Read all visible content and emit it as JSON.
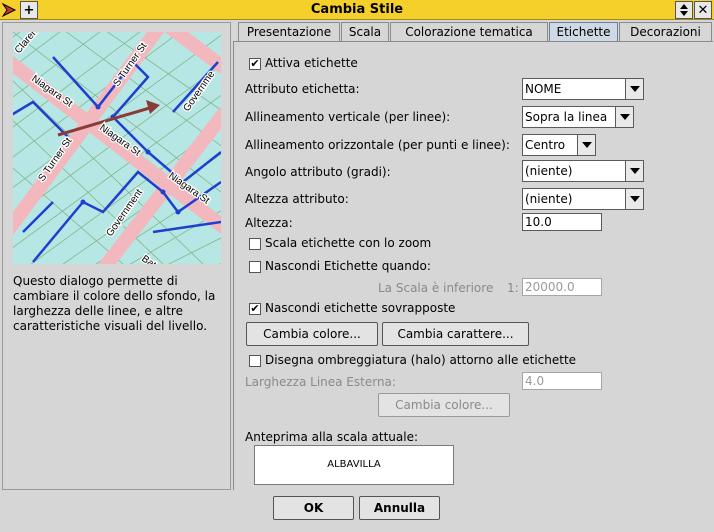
{
  "window": {
    "title": "Cambia Stile",
    "controls": [
      "arrow-updown-icon",
      "close-icon"
    ]
  },
  "map": {
    "street_labels": [
      "Claren",
      "Niagara St",
      "S Turner St",
      "Governme",
      "Niagara St",
      "S Turner St",
      "Niagara St",
      "Government",
      "Bat"
    ]
  },
  "description": "Questo dialogo  permette di cambiare il colore dello sfondo, la larghezza delle linee, e altre caratteristiche visuali del livello.",
  "tabs": [
    {
      "label": "Presentazione",
      "active": false
    },
    {
      "label": "Scala",
      "active": false
    },
    {
      "label": "Colorazione tematica",
      "active": false
    },
    {
      "label": "Etichette",
      "active": true
    },
    {
      "label": "Decorazioni",
      "active": false
    }
  ],
  "form": {
    "enable_labels": {
      "label": "Attiva etichette",
      "checked": true
    },
    "label_attribute": {
      "label": "Attributo etichetta:",
      "value": "NOME"
    },
    "vertical_alignment": {
      "label": "Allineamento verticale (per linee):",
      "value": "Sopra la linea"
    },
    "horizontal_alignment": {
      "label": "Allineamento orizzontale (per punti e linee):",
      "value": "Centro"
    },
    "angle_attribute": {
      "label": "Angolo attributo (gradi):",
      "value": "(niente)"
    },
    "height_attribute": {
      "label": "Altezza attributo:",
      "value": "(niente)"
    },
    "height": {
      "label": "Altezza:",
      "value": "10.0"
    },
    "scale_with_zoom": {
      "label": "Scala  etichette con lo zoom",
      "checked": false
    },
    "hide_labels_when": {
      "label": "Nascondi Etichette quando:",
      "checked": false
    },
    "scale_lower": {
      "label": "La Scala è inferiore",
      "prefix": "1:",
      "value": "20000.0"
    },
    "hide_overlapping": {
      "label": "Nascondi etichette sovrapposte",
      "checked": true
    },
    "change_color_button": "Cambia colore...",
    "change_font_button": "Cambia carattere...",
    "draw_halo": {
      "label": "Disegna ombreggiatura (halo) attorno alle etichette",
      "checked": false
    },
    "outline_width": {
      "label": "Larghezza  Linea Esterna:",
      "value": "4.0"
    },
    "halo_color_button": "Cambia colore...",
    "preview": {
      "label": "Anteprima alla scala attuale:",
      "sample": "ALBAVILLA"
    }
  },
  "footer": {
    "ok_button": "OK",
    "cancel_button": "Annulla"
  }
}
